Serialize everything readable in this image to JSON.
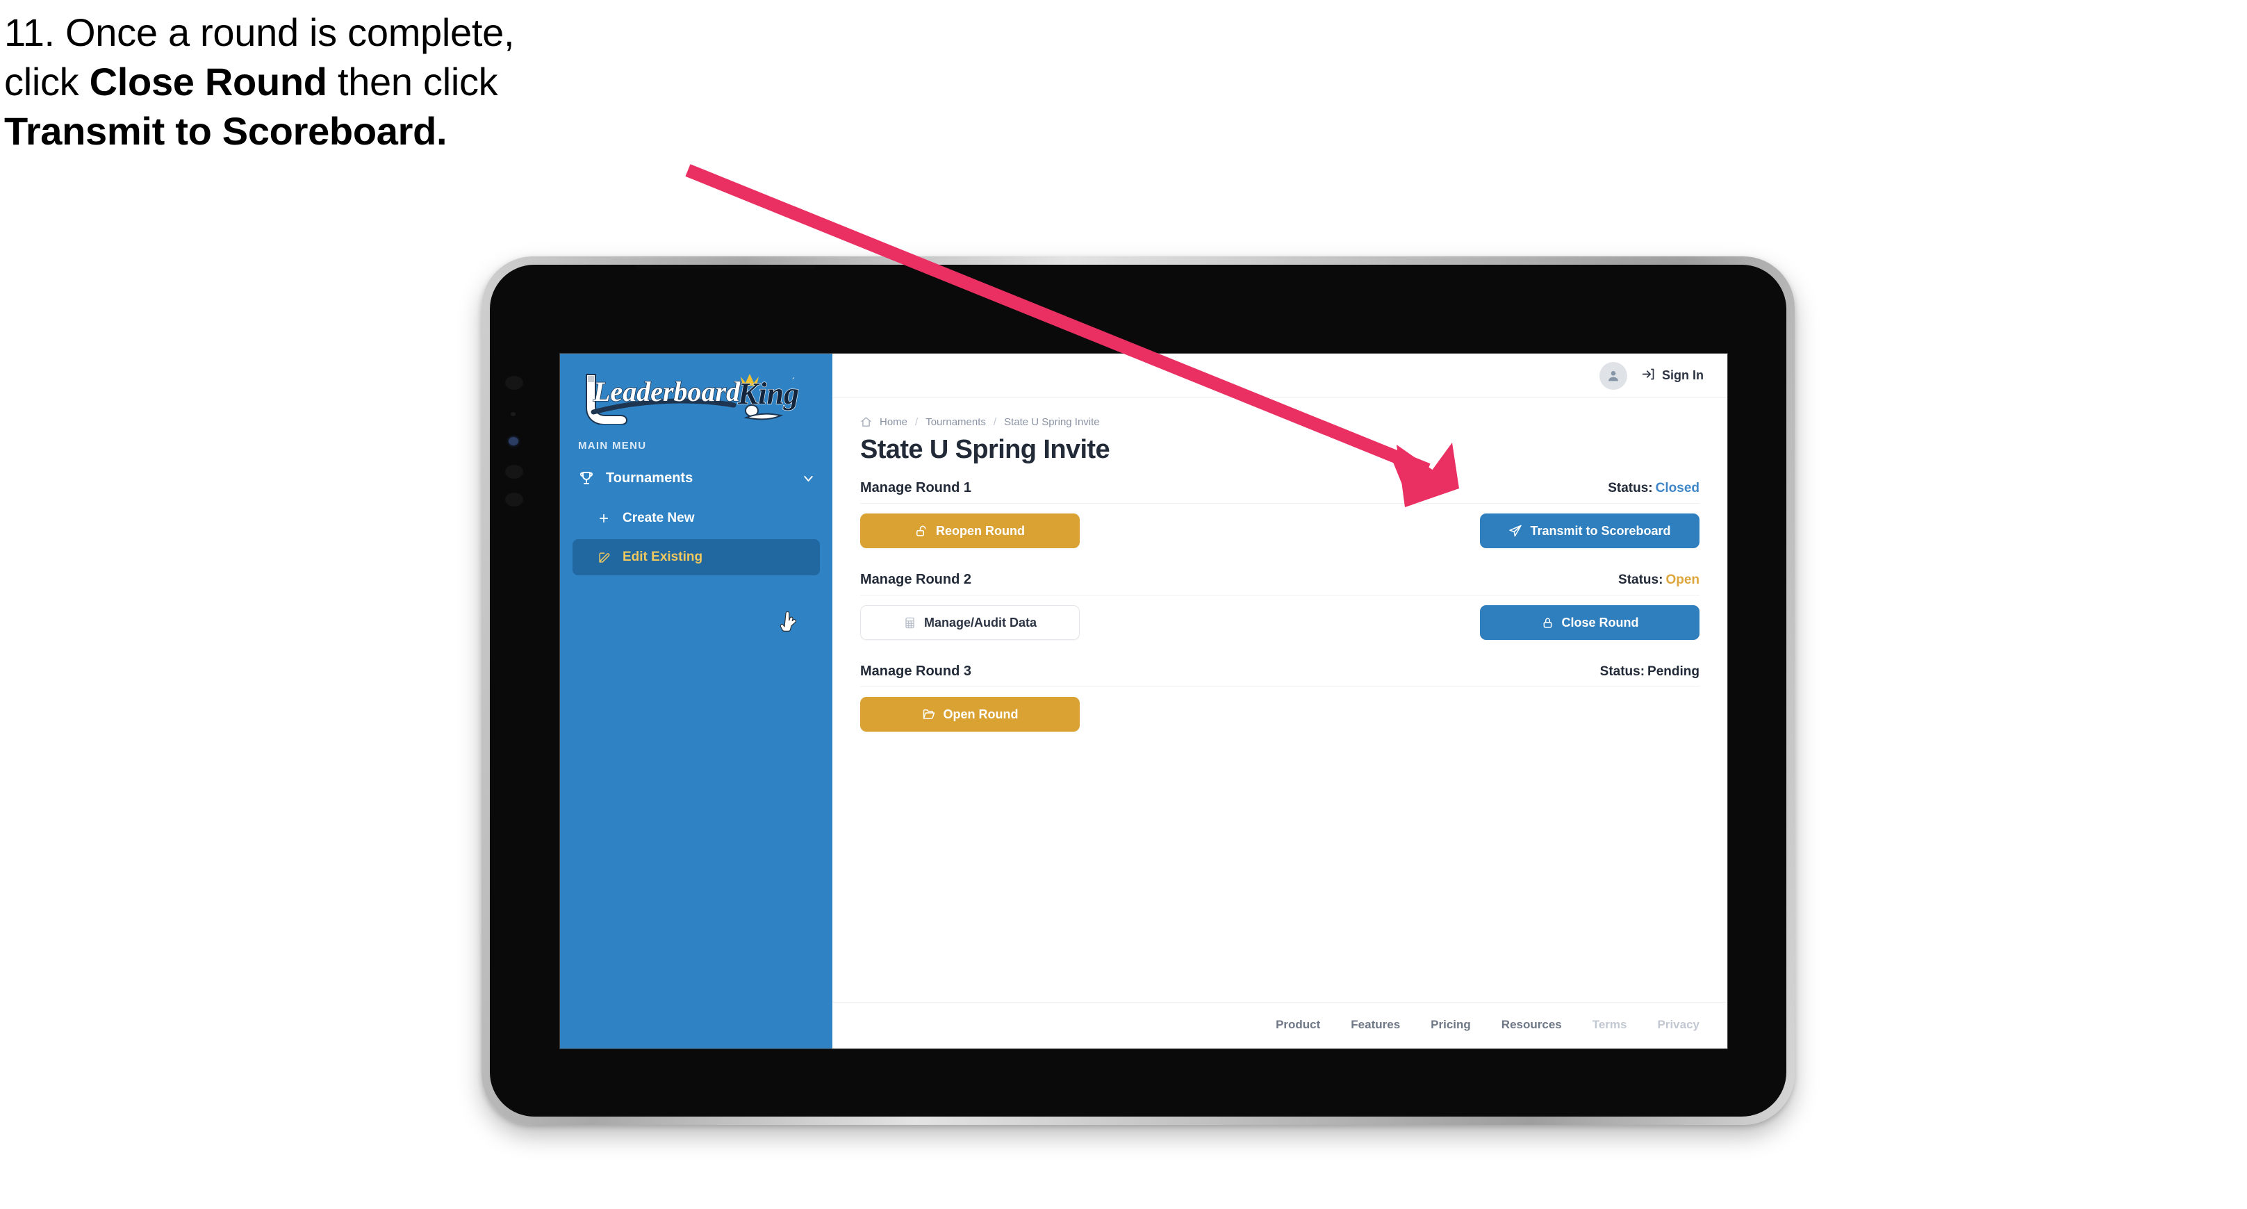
{
  "caption": {
    "line1_plain": "11. Once a round is complete,",
    "line2_pre": "click ",
    "line2_bold": "Close Round",
    "line2_post": " then click",
    "line3_bold": "Transmit to Scoreboard."
  },
  "annotation": {
    "arrow_color": "#ea2f63",
    "arrow_from": "990,245",
    "arrow_to": "2100,703"
  },
  "sidebar": {
    "logo_primary": "Leaderboard",
    "logo_secondary": "King",
    "section_label": "MAIN MENU",
    "nav": [
      {
        "label": "Tournaments",
        "icon": "trophy-icon",
        "chevron": "chevron-down-icon",
        "expanded": true
      }
    ],
    "sub_items": [
      {
        "label": "Create New",
        "icon": "plus-icon",
        "active": false
      },
      {
        "label": "Edit Existing",
        "icon": "pencil-square-icon",
        "active": true
      }
    ],
    "bg_color": "#2f82c4",
    "active_bg": "#2168a1",
    "active_text": "#efc85f"
  },
  "topbar": {
    "avatar_icon": "user-avatar-icon",
    "signin_icon": "sign-in-icon",
    "signin_label": "Sign In"
  },
  "breadcrumb": {
    "home_icon": "home-icon",
    "items": [
      "Home",
      "Tournaments",
      "State U Spring Invite"
    ],
    "separator": "/"
  },
  "page": {
    "title": "State U Spring Invite"
  },
  "rounds": [
    {
      "title": "Manage Round 1",
      "status_label": "Status:",
      "status_value": "Closed",
      "status_class": "closed",
      "left_button": {
        "label": "Reopen Round",
        "icon": "unlock-icon",
        "style": "btn-gold"
      },
      "right_button": {
        "label": "Transmit to Scoreboard",
        "icon": "paper-plane-icon",
        "style": "btn-blue"
      }
    },
    {
      "title": "Manage Round 2",
      "status_label": "Status:",
      "status_value": "Open",
      "status_class": "open",
      "left_button": {
        "label": "Manage/Audit Data",
        "icon": "table-grid-icon",
        "style": "btn-ghost"
      },
      "right_button": {
        "label": "Close Round",
        "icon": "lock-icon",
        "style": "btn-blue"
      }
    },
    {
      "title": "Manage Round 3",
      "status_label": "Status:",
      "status_value": "Pending",
      "status_class": "pending",
      "left_button": {
        "label": "Open Round",
        "icon": "folder-open-icon",
        "style": "btn-gold"
      },
      "right_button": null
    }
  ],
  "footer": {
    "links": [
      {
        "label": "Product",
        "muted": false
      },
      {
        "label": "Features",
        "muted": false
      },
      {
        "label": "Pricing",
        "muted": false
      },
      {
        "label": "Resources",
        "muted": false
      },
      {
        "label": "Terms",
        "muted": true
      },
      {
        "label": "Privacy",
        "muted": true
      }
    ]
  },
  "colors": {
    "brand_blue": "#2f82c4",
    "button_blue": "#2f7fbe",
    "gold": "#d9a233",
    "status_open": "#dda53c",
    "status_closed": "#3f87c9",
    "text_dark": "#222a38",
    "annotation_pink": "#ea2f63"
  }
}
